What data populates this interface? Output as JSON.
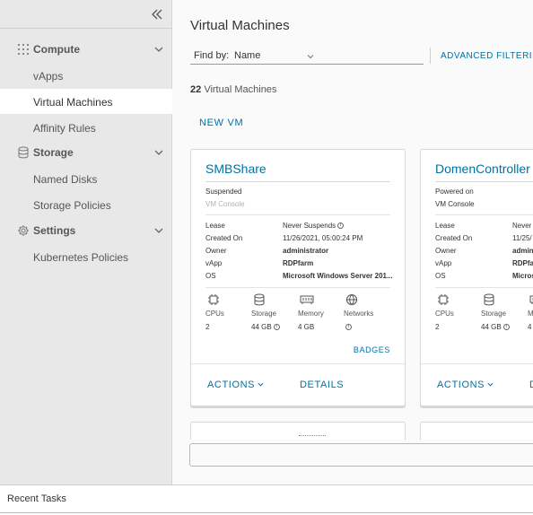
{
  "sidebar": {
    "sections": [
      {
        "label": "Compute",
        "icon": "grid-icon",
        "items": [
          {
            "label": "vApps"
          },
          {
            "label": "Virtual Machines",
            "active": true
          },
          {
            "label": "Affinity Rules"
          }
        ]
      },
      {
        "label": "Storage",
        "icon": "database-icon",
        "items": [
          {
            "label": "Named Disks"
          },
          {
            "label": "Storage Policies"
          }
        ]
      },
      {
        "label": "Settings",
        "icon": "gear-icon",
        "items": [
          {
            "label": "Kubernetes Policies"
          }
        ]
      }
    ]
  },
  "main": {
    "title": "Virtual Machines",
    "find_by_label": "Find by:",
    "find_by_value": "Name",
    "advanced_filtering": "ADVANCED FILTERING",
    "vm_count": "22",
    "vm_count_label": "Virtual Machines",
    "new_vm": "NEW VM"
  },
  "cards": [
    {
      "name": "SMBShare",
      "status": "Suspended",
      "console": "VM Console",
      "props": {
        "lease_key": "Lease",
        "lease": "Never Suspends",
        "created_key": "Created On",
        "created": "11/26/2021, 05:00:24 PM",
        "owner_key": "Owner",
        "owner": "administrator",
        "vapp_key": "vApp",
        "vapp": "RDPfarm",
        "os_key": "OS",
        "os": "Microsoft Windows Server 201..."
      },
      "resources": {
        "cpus_label": "CPUs",
        "cpus": "2",
        "storage_label": "Storage",
        "storage": "44 GB",
        "memory_label": "Memory",
        "memory": "4 GB",
        "networks_label": "Networks"
      },
      "badges": "BADGES",
      "actions": "ACTIONS",
      "details": "DETAILS"
    },
    {
      "name": "DomenController",
      "status": "Powered on",
      "console": "VM Console",
      "props": {
        "lease_key": "Lease",
        "lease": "Never",
        "created_key": "Created On",
        "created": "11/25/",
        "owner_key": "Owner",
        "owner": "admin",
        "vapp_key": "vApp",
        "vapp": "RDPfarm",
        "os_key": "OS",
        "os": "Micros"
      },
      "resources": {
        "cpus_label": "CPUs",
        "cpus": "2",
        "storage_label": "Storage",
        "storage": "44 GB",
        "memory_label": "M",
        "memory": "4"
      },
      "actions": "ACTIONS",
      "details": "D"
    }
  ],
  "footer": {
    "recent_tasks": "Recent Tasks"
  },
  "colors": {
    "accent": "#0072a3",
    "sidebar_bg": "#e8e8e8",
    "main_bg": "#fafafa"
  }
}
